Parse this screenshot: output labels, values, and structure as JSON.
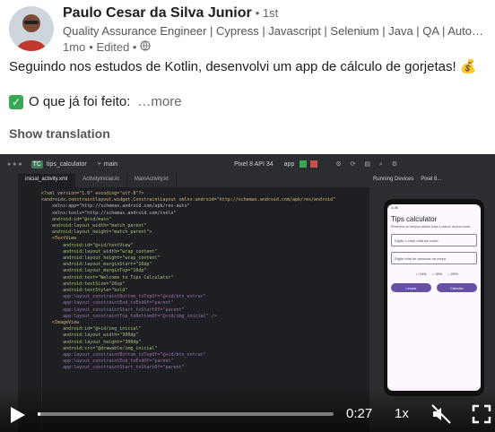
{
  "post": {
    "author_name": "Paulo Cesar da Silva Junior",
    "connection": "• 1st",
    "headline": "Quality Assurance Engineer | Cypress | Javascript | Selenium | Java | QA | Autom...",
    "time": "1mo",
    "edited": "• Edited •",
    "text_line1": "Seguindo nos estudos de Kotlin, desenvolvi um app de cálculo de gorjetas! 💰",
    "text_line2": "O que já foi feito:",
    "more_label": "…more",
    "show_translation": "Show translation"
  },
  "ide": {
    "project": "tips_calculator",
    "branch": "main",
    "device": "Pixel 8 API 34",
    "run_config": "app",
    "tabs": [
      "inicial_activity.xml",
      "ActivityInicial.kt",
      "MainActivity.kt"
    ],
    "right_tabs": [
      "Running Devices",
      "Pixel 8..."
    ],
    "code_lines": [
      "<?xml version=\"1.0\" encoding=\"utf-8\"?>",
      "<androidx.constraintlayout.widget.ConstraintLayout xmlns:android=\"http://schemas.android.com/apk/res/android\"",
      "    xmlns:app=\"http://schemas.android.com/apk/res-auto\"",
      "    xmlns:tools=\"http://schemas.android.com/tools\"",
      "    android:id=\"@+id/main\"",
      "    android:layout_width=\"match_parent\"",
      "    android:layout_height=\"match_parent\">",
      "",
      "    <TextView",
      "        android:id=\"@+id/textView\"",
      "        android:layout_width=\"wrap_content\"",
      "        android:layout_height=\"wrap_content\"",
      "        android:layout_marginStart=\"16dp\"",
      "        android:layout_marginTop=\"16dp\"",
      "        android:text=\"Welcome to Tips Calculator\"",
      "        android:textSize=\"20sp\"",
      "        android:textStyle=\"bold\"",
      "        app:layout_constraintBottom_toTopOf=\"@+id/btn_entrar\"",
      "        app:layout_constraintEnd_toEndOf=\"parent\"",
      "        app:layout_constraintStart_toStartOf=\"parent\"",
      "        app:layout_constraintTop_toBottomOf=\"@+id/img_inicial\" />",
      "",
      "    <ImageView",
      "        android:id=\"@+id/img_inicial\"",
      "        android:layout_width=\"300dp\"",
      "        android:layout_height=\"300dp\"",
      "        android:src=\"@drawable/img_inicial\"",
      "        app:layout_constraintBottom_toTopOf=\"@+id/btn_entrar\"",
      "        app:layout_constraintEnd_toEndOf=\"parent\"",
      "        app:layout_constraintStart_toStartOf=\"parent\""
    ],
    "app_preview": {
      "status": "1:26",
      "title": "Tips calculator",
      "subtitle": "Preencha os campos abaixo para o cálculo da sua conta",
      "field1": "Digite o valor total da conta",
      "field2": "Digite total de pessoas na mesa",
      "radios": [
        "10%",
        "15%",
        "20%"
      ],
      "btn_clear": "Limpar",
      "btn_calc": "Calcular"
    }
  },
  "video": {
    "time_remaining": "0:27",
    "speed": "1x",
    "progress": 0.01
  },
  "colors": {
    "accent": "#3aa757",
    "app_primary": "#6750a4"
  }
}
